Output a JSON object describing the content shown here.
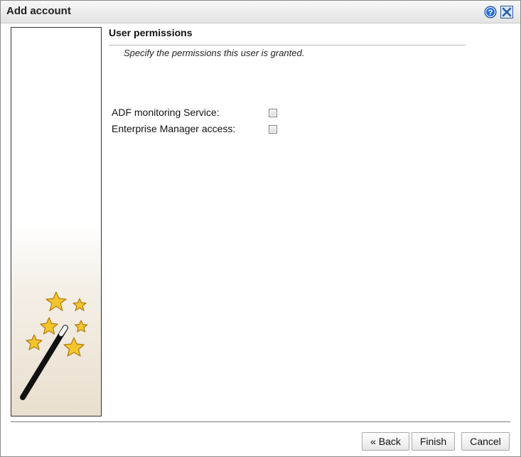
{
  "window": {
    "title": "Add account",
    "help_icon": "help-icon",
    "close_icon": "close-icon"
  },
  "section": {
    "title": "User permissions",
    "description": "Specify the permissions this user is granted."
  },
  "permissions": [
    {
      "label": "ADF monitoring Service:",
      "checked": false
    },
    {
      "label": "Enterprise Manager access:",
      "checked": false
    }
  ],
  "buttons": {
    "back": "« Back",
    "finish": "Finish",
    "cancel": "Cancel"
  },
  "colors": {
    "help_icon": "#2a6fcf",
    "close_icon": "#2a5d9e",
    "star_fill": "#f3c52c",
    "star_outline": "#b07a10"
  }
}
